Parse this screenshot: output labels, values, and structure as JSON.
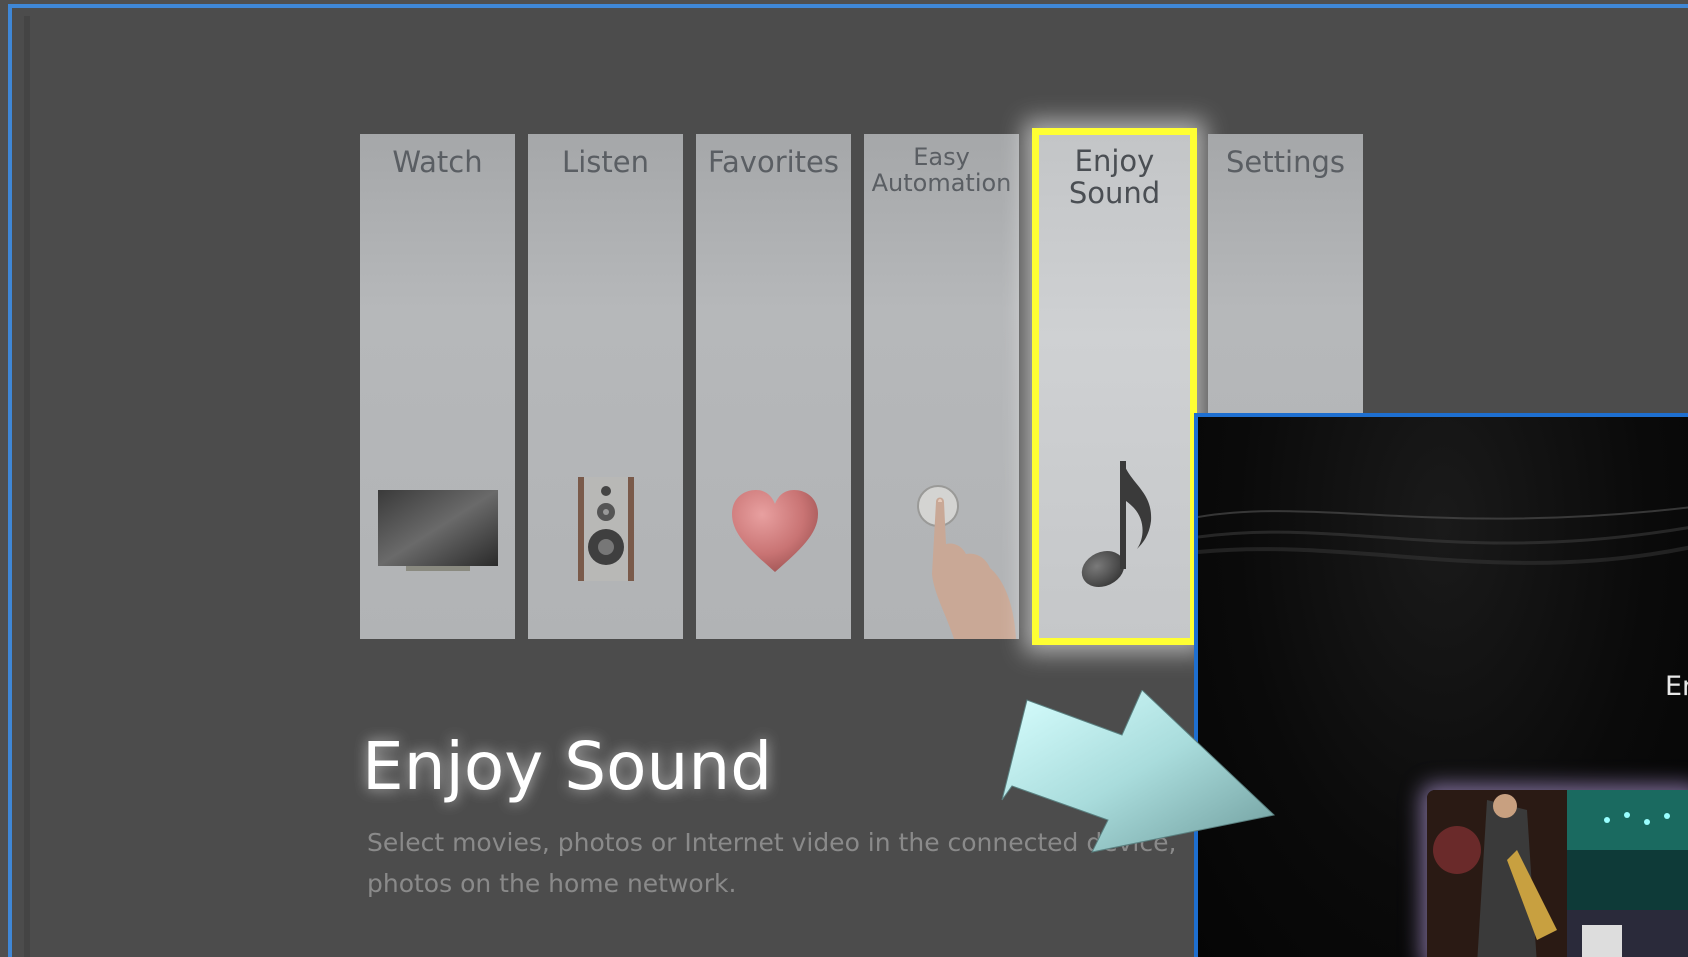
{
  "menu": {
    "tiles": [
      {
        "label": "Watch",
        "icon": "tv-icon"
      },
      {
        "label": "Listen",
        "icon": "speaker-icon"
      },
      {
        "label": "Favorites",
        "icon": "heart-icon"
      },
      {
        "label_line1": "Easy",
        "label_line2": "Automation",
        "icon": "finger-button-icon"
      },
      {
        "label_line1": "Enjoy",
        "label_line2": "Sound",
        "icon": "music-note-icon",
        "selected": true
      },
      {
        "label": "Settings"
      }
    ]
  },
  "info": {
    "title": "Enjoy Sound",
    "description_line1": "Select movies, photos or Internet video in the connected device,",
    "description_line2": "photos on the home network."
  },
  "preview": {
    "text": "En"
  },
  "colors": {
    "highlight_border": "#ffff33",
    "frame_border": "#3f87d6",
    "preview_border": "#1e6fd0"
  }
}
